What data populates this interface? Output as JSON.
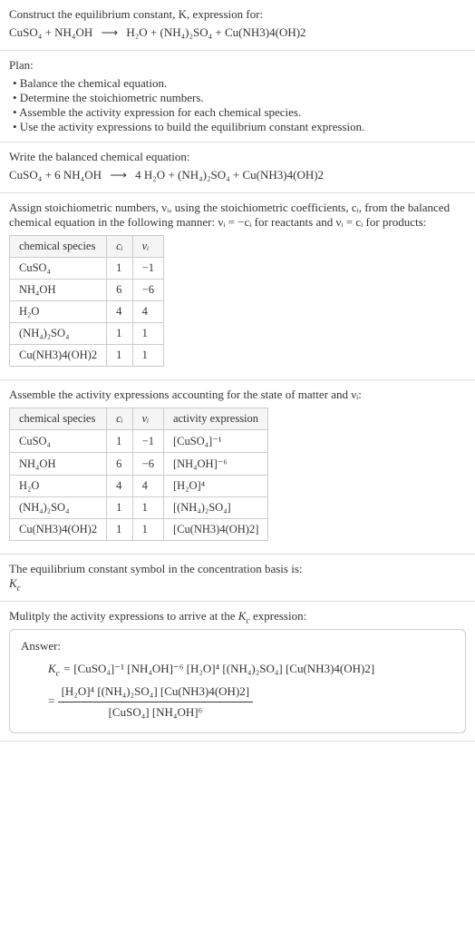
{
  "intro": {
    "line1": "Construct the equilibrium constant, K, expression for:",
    "equation_lhs": "CuSO₄ + NH₄OH",
    "equation_rhs": "H₂O + (NH₄)₂SO₄ + Cu(NH3)4(OH)2"
  },
  "plan": {
    "heading": "Plan:",
    "b1": "• Balance the chemical equation.",
    "b2": "• Determine the stoichiometric numbers.",
    "b3": "• Assemble the activity expression for each chemical species.",
    "b4": "• Use the activity expressions to build the equilibrium constant expression."
  },
  "balanced": {
    "heading": "Write the balanced chemical equation:",
    "lhs": "CuSO₄ + 6 NH₄OH",
    "rhs": "4 H₂O + (NH₄)₂SO₄ + Cu(NH3)4(OH)2"
  },
  "stoich": {
    "text1": "Assign stoichiometric numbers, νᵢ, using the stoichiometric coefficients, cᵢ, from the balanced chemical equation in the following manner: νᵢ = −cᵢ for reactants and νᵢ = cᵢ for products:",
    "h1": "chemical species",
    "h2": "cᵢ",
    "h3": "νᵢ",
    "r1c1": "CuSO₄",
    "r1c2": "1",
    "r1c3": "−1",
    "r2c1": "NH₄OH",
    "r2c2": "6",
    "r2c3": "−6",
    "r3c1": "H₂O",
    "r3c2": "4",
    "r3c3": "4",
    "r4c1": "(NH₄)₂SO₄",
    "r4c2": "1",
    "r4c3": "1",
    "r5c1": "Cu(NH3)4(OH)2",
    "r5c2": "1",
    "r5c3": "1"
  },
  "activity": {
    "text1": "Assemble the activity expressions accounting for the state of matter and νᵢ:",
    "h1": "chemical species",
    "h2": "cᵢ",
    "h3": "νᵢ",
    "h4": "activity expression",
    "r1c1": "CuSO₄",
    "r1c2": "1",
    "r1c3": "−1",
    "r1c4": "[CuSO₄]⁻¹",
    "r2c1": "NH₄OH",
    "r2c2": "6",
    "r2c3": "−6",
    "r2c4": "[NH₄OH]⁻⁶",
    "r3c1": "H₂O",
    "r3c2": "4",
    "r3c3": "4",
    "r3c4": "[H₂O]⁴",
    "r4c1": "(NH₄)₂SO₄",
    "r4c2": "1",
    "r4c3": "1",
    "r4c4": "[(NH₄)₂SO₄]",
    "r5c1": "Cu(NH3)4(OH)2",
    "r5c2": "1",
    "r5c3": "1",
    "r5c4": "[Cu(NH3)4(OH)2]"
  },
  "symbol": {
    "text1": "The equilibrium constant symbol in the concentration basis is:",
    "kc": "K_c"
  },
  "multiply": {
    "text1": "Mulitply the activity expressions to arrive at the K_c expression:"
  },
  "answer": {
    "label": "Answer:",
    "line1_lhs": "K_c =",
    "line1_rhs": "[CuSO₄]⁻¹ [NH₄OH]⁻⁶ [H₂O]⁴ [(NH₄)₂SO₄] [Cu(NH3)4(OH)2]",
    "eq": "=",
    "frac_num": "[H₂O]⁴ [(NH₄)₂SO₄] [Cu(NH3)4(OH)2]",
    "frac_den": "[CuSO₄] [NH₄OH]⁶"
  }
}
